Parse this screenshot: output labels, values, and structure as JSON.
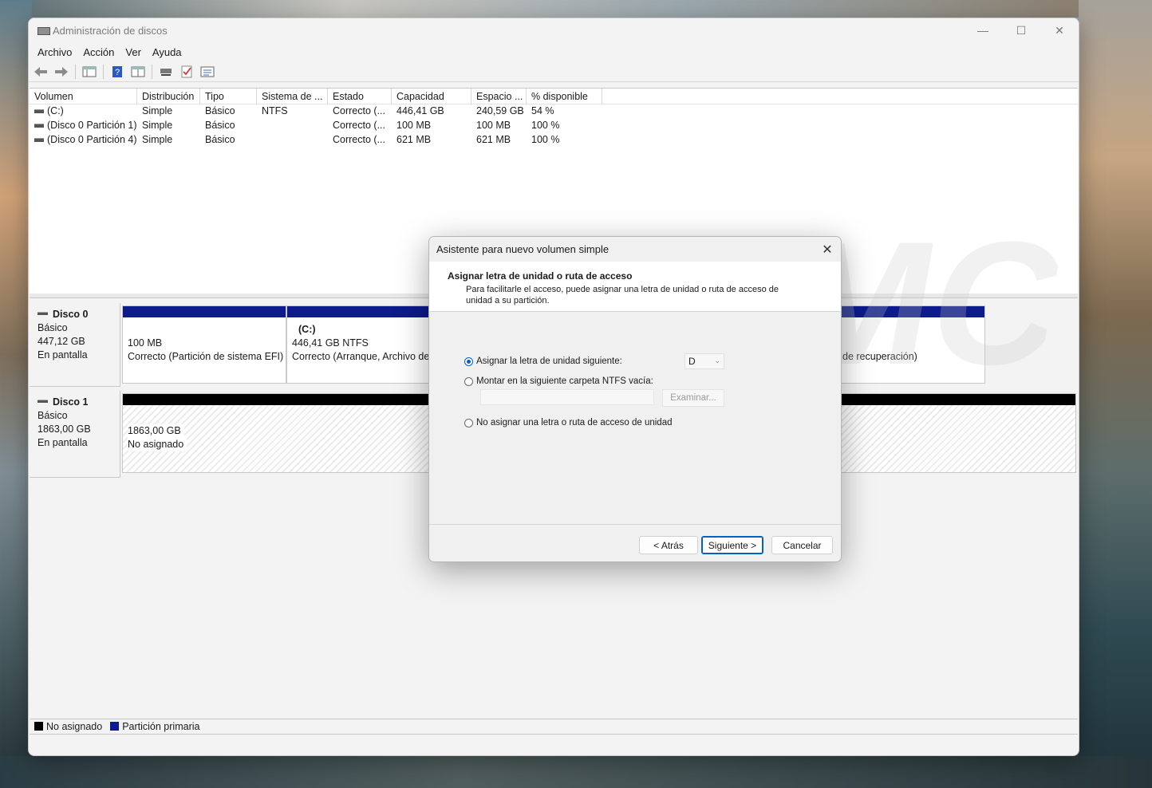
{
  "window": {
    "title": "Administración de discos",
    "controls": [
      "minimize",
      "maximize",
      "close"
    ]
  },
  "menu": [
    "Archivo",
    "Acción",
    "Ver",
    "Ayuda"
  ],
  "toolbar": {
    "icons": [
      "back-arrow-icon",
      "forward-arrow-icon",
      "console-tree-icon",
      "help-icon",
      "properties-icon",
      "rescan-icon",
      "checklist-icon",
      "list-view-icon"
    ]
  },
  "volume_table": {
    "columns": [
      "Volumen",
      "Distribución",
      "Tipo",
      "Sistema de ...",
      "Estado",
      "Capacidad",
      "Espacio ...",
      "% disponible"
    ],
    "rows": [
      [
        "(C:)",
        "Simple",
        "Básico",
        "NTFS",
        "Correcto (...",
        "446,41 GB",
        "240,59 GB",
        "54 %"
      ],
      [
        "(Disco 0 Partición 1)",
        "Simple",
        "Básico",
        "",
        "Correcto (...",
        "100 MB",
        "100 MB",
        "100 %"
      ],
      [
        "(Disco 0 Partición 4)",
        "Simple",
        "Básico",
        "",
        "Correcto (...",
        "621 MB",
        "621 MB",
        "100 %"
      ]
    ]
  },
  "disks": {
    "disk0": {
      "name": "Disco 0",
      "type": "Básico",
      "size": "447,12 GB",
      "status": "En pantalla",
      "parts": {
        "efi": {
          "size": "100 MB",
          "status": "Correcto (Partición de sistema EFI)"
        },
        "c": {
          "label": "(C:)",
          "size": "446,41 GB NTFS",
          "status": "Correcto (Arranque, Archivo de"
        },
        "recovery": {
          "status": "de recuperación)"
        }
      }
    },
    "disk1": {
      "name": "Disco 1",
      "type": "Básico",
      "size": "1863,00 GB",
      "status": "En pantalla",
      "parts": {
        "unalloc": {
          "size": "1863,00 GB",
          "status": "No asignado"
        }
      }
    }
  },
  "legend": {
    "unallocated": "No asignado",
    "primary": "Partición primaria",
    "unallocated_color": "#000000",
    "primary_color": "#0d1b8c"
  },
  "dialog": {
    "title": "Asistente para nuevo volumen simple",
    "heading": "Asignar letra de unidad o ruta de acceso",
    "description": "Para facilitarle el acceso, puede asignar una letra de unidad o ruta de acceso de unidad a su partición.",
    "options": {
      "assign_letter": "Asignar la letra de unidad siguiente:",
      "mount_folder": "Montar en la siguiente carpeta NTFS vacía:",
      "no_letter": "No asignar una letra o ruta de acceso de unidad"
    },
    "selected_letter": "D",
    "browse": "Examinar...",
    "buttons": {
      "back": "< Atrás",
      "next": "Siguiente >",
      "cancel": "Cancelar"
    }
  }
}
